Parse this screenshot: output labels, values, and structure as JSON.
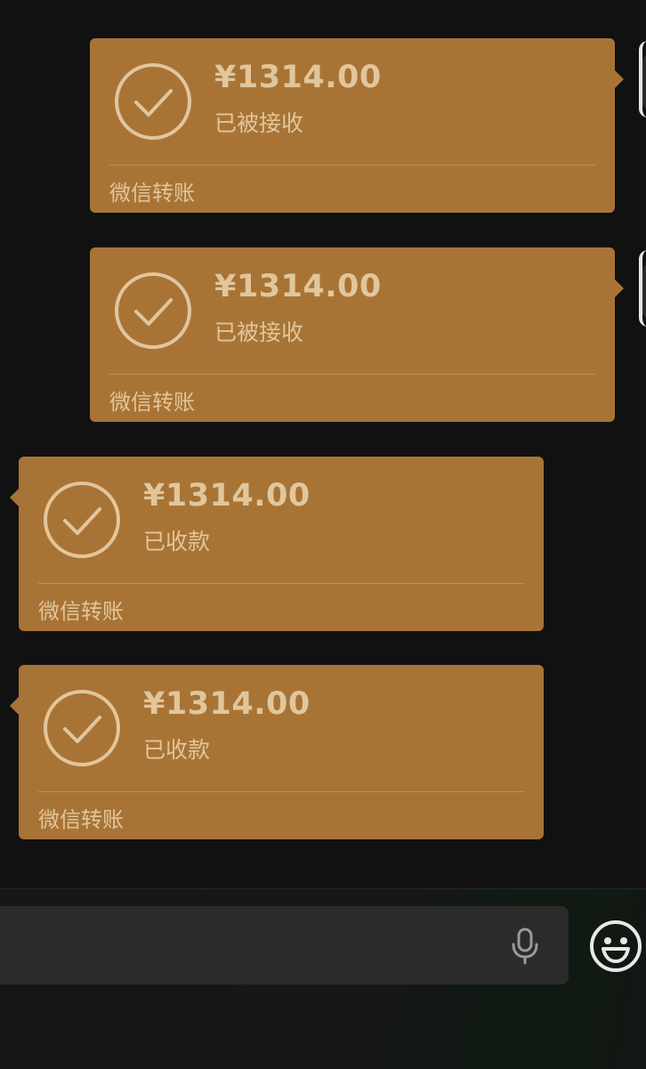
{
  "messages": [
    {
      "direction": "sent",
      "amount": "¥1314.00",
      "status": "已被接收",
      "label": "微信转账"
    },
    {
      "direction": "sent",
      "amount": "¥1314.00",
      "status": "已被接收",
      "label": "微信转账"
    },
    {
      "direction": "received",
      "amount": "¥1314.00",
      "status": "已收款",
      "label": "微信转账"
    },
    {
      "direction": "received",
      "amount": "¥1314.00",
      "status": "已收款",
      "label": "微信转账"
    }
  ],
  "input_bar": {
    "text": "",
    "icons": [
      "microphone-icon",
      "emoji-icon"
    ]
  },
  "colors": {
    "background": "#111111",
    "transfer_card": "#a87436",
    "transfer_text": "#e1c69b",
    "input_field": "#2b2b2b"
  }
}
